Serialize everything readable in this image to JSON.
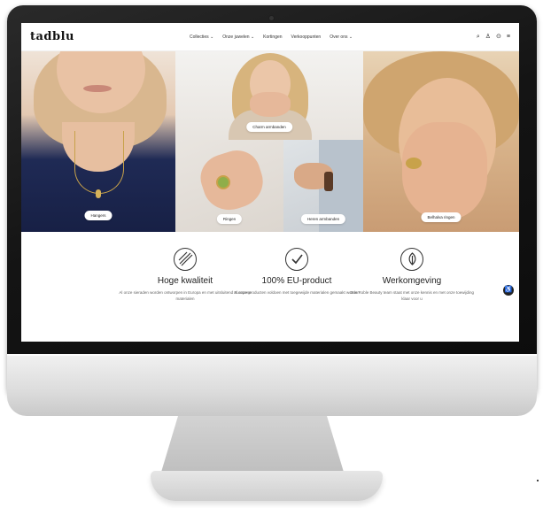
{
  "site": {
    "logo": "tadblu"
  },
  "nav": {
    "menu": [
      {
        "label": "Collecties ⌄"
      },
      {
        "label": "Onze juwelen ⌄"
      },
      {
        "label": "Kortingen"
      },
      {
        "label": "Verkooppunten"
      },
      {
        "label": "Over ons ⌄"
      }
    ]
  },
  "tiles": {
    "hangers": "Hangers",
    "charm_armbanden": "Charm armbanden",
    "ringen": "Ringen",
    "heren_armbanden": "Heren armbanden",
    "belhalva_ringen": "Belhalva ringen"
  },
  "features": [
    {
      "title": "Hoge kwaliteit",
      "text": "Al onze sieraden worden ontworpen in Europa en met uitsluitend Europese materialen"
    },
    {
      "title": "100% EU-product",
      "text": "Al onze producten voldoen met toegewijde materialen gemaakt worden"
    },
    {
      "title": "Werkomgeving",
      "text": "Ons Roble Beauty team staat met onze kennis en met onze toewijding klaar voor u"
    }
  ]
}
